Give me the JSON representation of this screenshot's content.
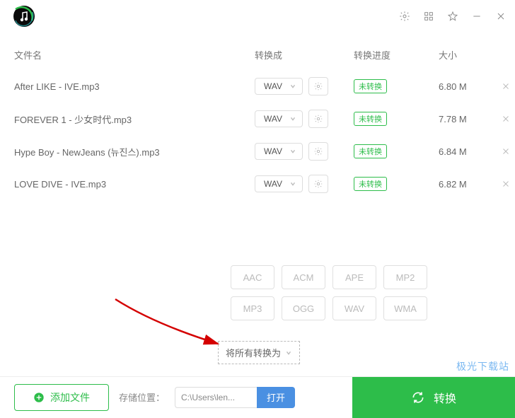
{
  "headers": {
    "name": "文件名",
    "format": "转换成",
    "progress": "转换进度",
    "size": "大小"
  },
  "files": [
    {
      "name": "After LIKE - IVE.mp3",
      "format": "WAV",
      "status": "未转换",
      "size": "6.80 M"
    },
    {
      "name": "FOREVER 1 - 少女时代.mp3",
      "format": "WAV",
      "status": "未转换",
      "size": "7.78 M"
    },
    {
      "name": "Hype Boy - NewJeans (뉴진스).mp3",
      "format": "WAV",
      "status": "未转换",
      "size": "6.84 M"
    },
    {
      "name": "LOVE DIVE - IVE.mp3",
      "format": "WAV",
      "status": "未转换",
      "size": "6.82 M"
    }
  ],
  "formatOptions": [
    "AAC",
    "ACM",
    "APE",
    "MP2",
    "MP3",
    "OGG",
    "WAV",
    "WMA"
  ],
  "convertAll": {
    "label": "将所有转换为"
  },
  "bottom": {
    "addFile": "添加文件",
    "storageLabel": "存储位置：",
    "path": "C:\\Users\\len...",
    "open": "打开",
    "convert": "转换"
  },
  "watermark": "极光下载站"
}
